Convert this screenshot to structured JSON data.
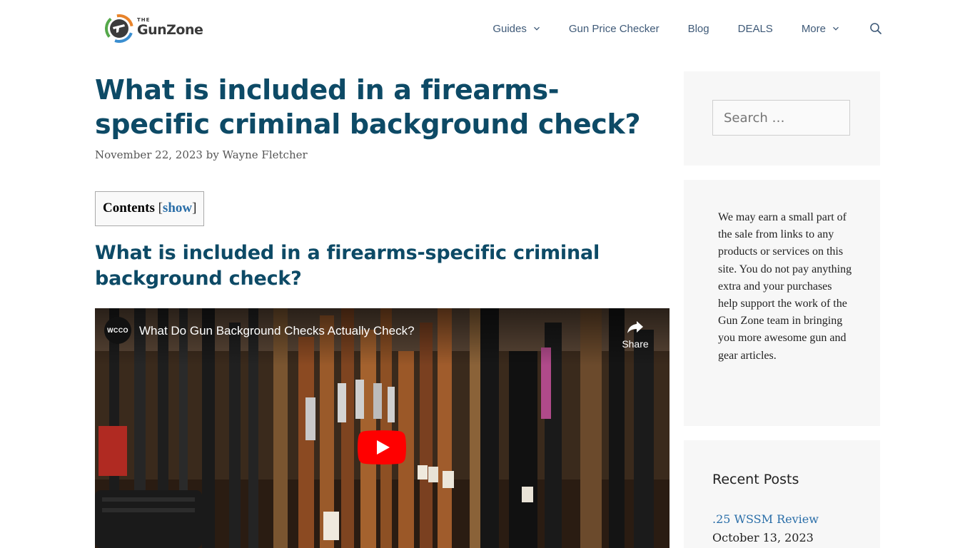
{
  "header": {
    "logo_small": "THE",
    "logo_name": "GunZone",
    "nav": [
      {
        "label": "Guides",
        "has_dropdown": true
      },
      {
        "label": "Gun Price Checker",
        "has_dropdown": false
      },
      {
        "label": "Blog",
        "has_dropdown": false
      },
      {
        "label": "DEALS",
        "has_dropdown": false
      },
      {
        "label": "More",
        "has_dropdown": true
      }
    ],
    "search_icon": "search-icon"
  },
  "article": {
    "title": "What is included in a firearms-specific criminal background check?",
    "date": "November 22, 2023",
    "by": "by",
    "author": "Wayne Fletcher",
    "toc": {
      "title": "Contents",
      "open_bracket": "[",
      "toggle": "show",
      "close_bracket": "]"
    },
    "section_heading": "What is included in a firearms-specific criminal background check?"
  },
  "video": {
    "channel_badge": "WCCO",
    "title": "What Do Gun Background Checks Actually Check?",
    "share_label": "Share",
    "play_icon": "play-icon",
    "colors": {
      "play": "#ff0000",
      "overlay_text": "#ffffff"
    }
  },
  "sidebar": {
    "search_placeholder": "Search …",
    "disclaimer": "We may earn a small part of the sale from links to any products or services on this site. You do not pay anything extra and your purchases help support the work of the Gun Zone team in bringing you more awesome gun and gear articles.",
    "recent_title": "Recent Posts",
    "recent_posts": [
      {
        "title": ".25 WSSM Review",
        "date": "October 13, 2023"
      }
    ]
  },
  "colors": {
    "heading": "#0d4a66",
    "nav": "#3f5a78",
    "link": "#2a6ea8",
    "sidebar_bg": "#f7f7f7"
  }
}
